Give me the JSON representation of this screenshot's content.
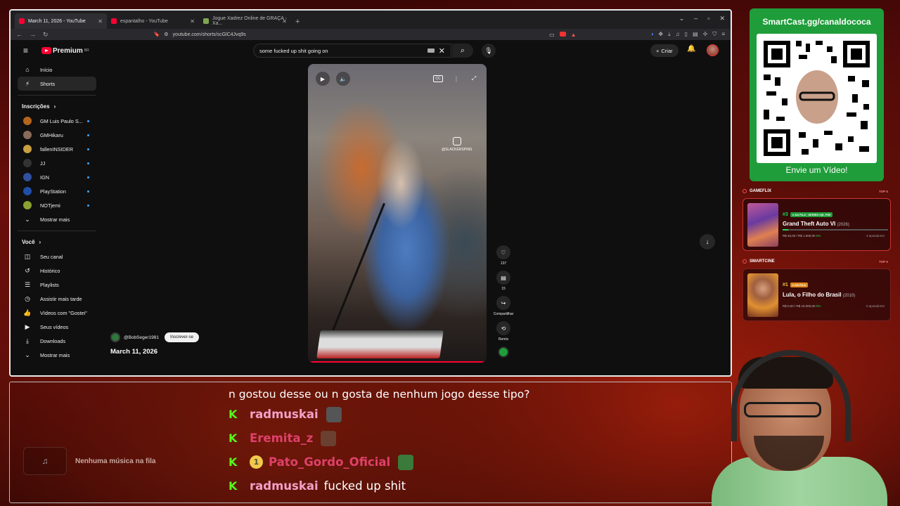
{
  "browser": {
    "tabs": [
      {
        "label": "March 11, 2026 - YouTube",
        "active": true,
        "favicon_color": "#ff0033"
      },
      {
        "label": "espantalho - YouTube",
        "active": false,
        "favicon_color": "#ff0033"
      },
      {
        "label": "Jogue Xadrez Online de GRAÇA - Xa...",
        "active": false,
        "favicon_color": "#7fa650"
      }
    ],
    "url": "youtube.com/shorts/scGlC4Jvq9s"
  },
  "youtube": {
    "logo_text": "Premium",
    "logo_sup": "BR",
    "search_value": "some fucked up shit going on",
    "create_label": "Criar",
    "sidebar": {
      "top": [
        {
          "label": "Início",
          "icon": "home-icon",
          "glyph": "⌂",
          "active": false
        },
        {
          "label": "Shorts",
          "icon": "shorts-icon",
          "glyph": "⚡",
          "active": true
        }
      ],
      "subs_heading": "Inscrições",
      "subscriptions": [
        {
          "label": "GM Luis Paulo S...",
          "color": "#b5651d"
        },
        {
          "label": "GMHikaru",
          "color": "#8a6a5a"
        },
        {
          "label": "fallenINSIDER",
          "color": "#c8a040"
        },
        {
          "label": "JJ",
          "color": "#333333"
        },
        {
          "label": "IGN",
          "color": "#3050a0"
        },
        {
          "label": "PlayStation",
          "color": "#1f4fa8"
        },
        {
          "label": "NOTjemi",
          "color": "#8aa030"
        }
      ],
      "show_more": "Mostrar mais",
      "you_heading": "Você",
      "you_items": [
        {
          "label": "Seu canal",
          "icon": "channel-icon",
          "glyph": "◫"
        },
        {
          "label": "Histórico",
          "icon": "history-icon",
          "glyph": "↺"
        },
        {
          "label": "Playlists",
          "icon": "playlists-icon",
          "glyph": "☰"
        },
        {
          "label": "Assistir mais tarde",
          "icon": "clock-icon",
          "glyph": "◷"
        },
        {
          "label": "Vídeos com \"Gostei\"",
          "icon": "thumbs-up-icon",
          "glyph": "👍"
        },
        {
          "label": "Seus vídeos",
          "icon": "video-icon",
          "glyph": "▶"
        },
        {
          "label": "Downloads",
          "icon": "download-icon",
          "glyph": "⤓"
        },
        {
          "label": "Mostrar mais",
          "icon": "chevron-down-icon",
          "glyph": "⌄"
        }
      ]
    },
    "short": {
      "watermark": "@SLACKERSPINS",
      "like_count": "137",
      "comment_count": "15",
      "share_label": "Compartilhar",
      "remix_label": "Remix",
      "progress": 1.0
    },
    "channel": {
      "name": "@BobSeger1981",
      "subscribe_label": "Inscrever-se"
    },
    "video_title": "March 11, 2026"
  },
  "overlay": {
    "qr": {
      "header": "SmartCast.gg/canaldococa",
      "footer": "Envie um Vídeo!"
    },
    "gameflix": {
      "label": "GAMEFLIX",
      "top_tag": "TOP 5",
      "rank": "#3",
      "status": "● NA FILA · SERIES X|S, PS5",
      "title": "Grand Theft Auto VI",
      "year": "(2026)",
      "raised": "R$ 45,00",
      "goal": "/ R$ 1.000,00",
      "pct": "5%",
      "pct_value": 0.05,
      "supporters": "3 apoiadores"
    },
    "smartcine": {
      "label": "SMARTCINE",
      "top_tag": "TOP 5",
      "rank": "#1",
      "status": "● NA FILA",
      "title": "Lula, o Filho do Brasil",
      "year": "(2010)",
      "raised": "R$ 0,00",
      "goal": "/ R$ 15.000,00",
      "pct": "0%",
      "pct_value": 0.0,
      "supporters": "0 apoiadores"
    },
    "music": {
      "empty_label": "Nenhuma música na fila"
    },
    "chat": {
      "first_line": "n gostou desse ou n gosta de nenhum jogo desse tipo?",
      "messages": [
        {
          "user": "radmuskai",
          "color": "#f3a0c8",
          "message": "",
          "badge": "",
          "emote_color": "#555"
        },
        {
          "user": "Eremita_z",
          "color": "#e0406a",
          "message": "",
          "badge": "",
          "emote_color": "#6a4030"
        },
        {
          "user": "Pato_Gordo_Oficial",
          "color": "#e0406a",
          "message": "",
          "badge": "1",
          "emote_color": "#3a7a3a"
        },
        {
          "user": "radmuskai",
          "color": "#f3a0c8",
          "message": "fucked up shit",
          "badge": "",
          "emote_color": ""
        }
      ]
    }
  }
}
